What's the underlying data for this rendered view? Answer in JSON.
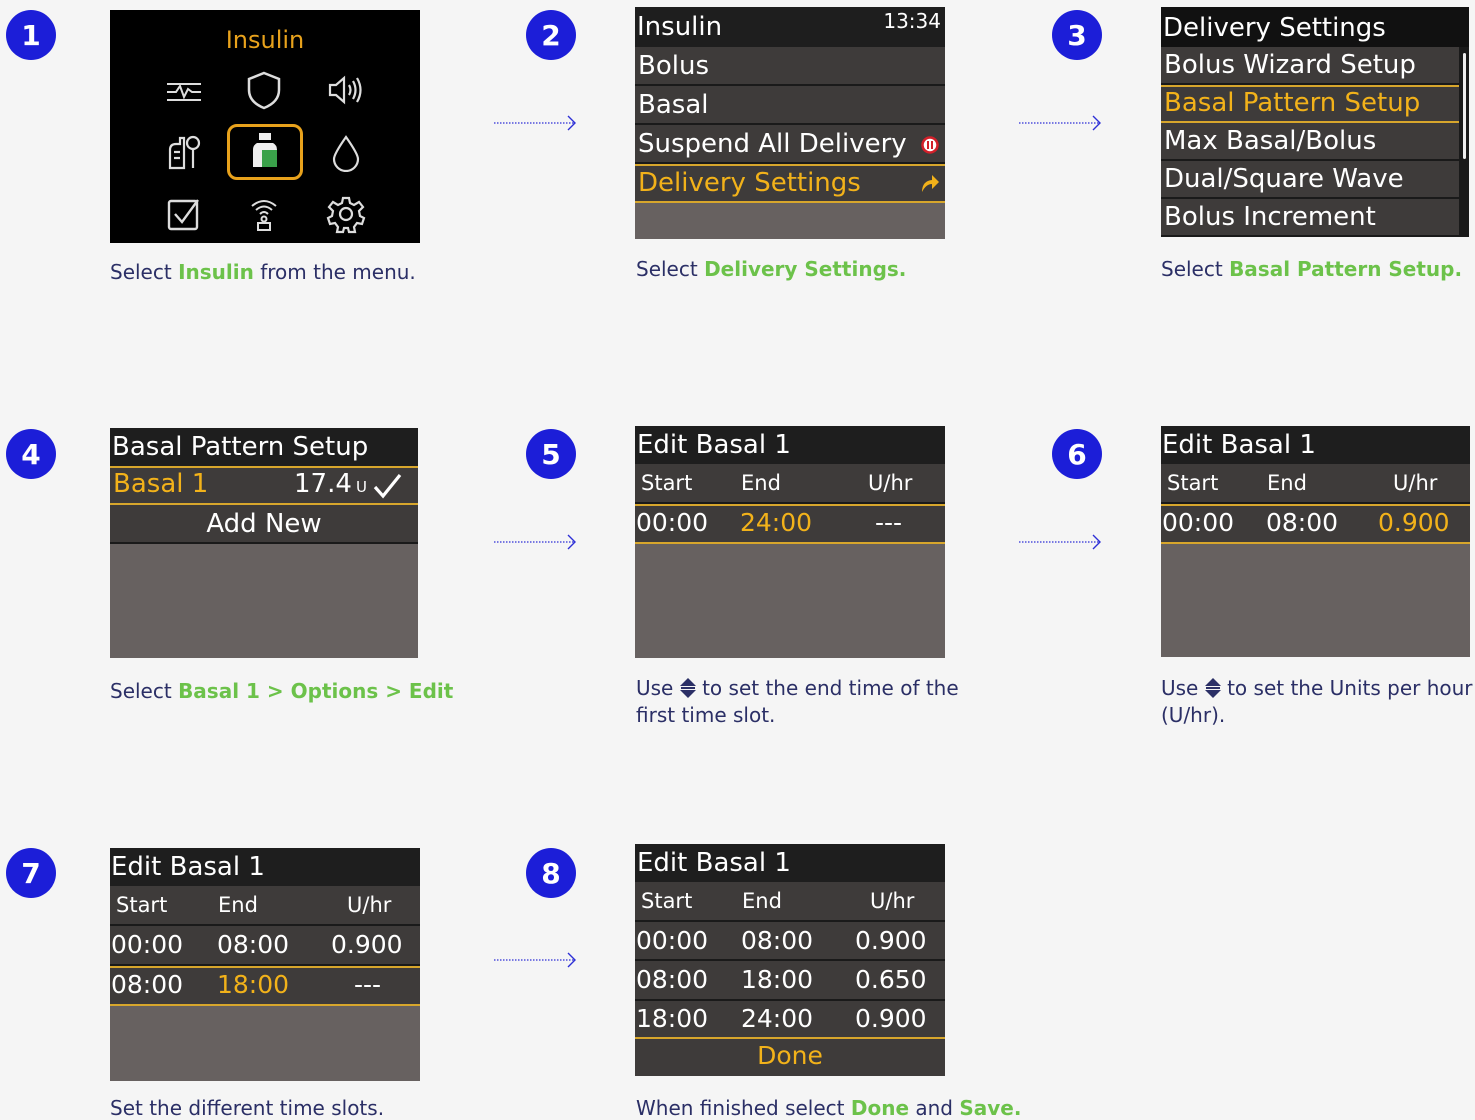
{
  "steps": [
    {
      "num": "1",
      "caption_pre": "Select ",
      "caption_hl": "Insulin",
      "caption_post": " from the menu."
    },
    {
      "num": "2",
      "caption_pre": "Select ",
      "caption_hl": "Delivery Settings.",
      "caption_post": ""
    },
    {
      "num": "3",
      "caption_pre": "Select ",
      "caption_hl": "Basal Pattern Setup.",
      "caption_post": ""
    },
    {
      "num": "4",
      "caption_pre": "Select ",
      "caption_hl": "Basal 1 > Options > Edit",
      "caption_post": ""
    },
    {
      "num": "5",
      "caption_line1": "Use",
      "caption_line1b": "to set the end time of the",
      "caption_line2": "first time slot."
    },
    {
      "num": "6",
      "caption_line1": "Use",
      "caption_line1b": "to set the Units per hour",
      "caption_line2": "(U/hr)."
    },
    {
      "num": "7",
      "caption_pre": "Set the different time slots.",
      "caption_hl": "",
      "caption_post": ""
    },
    {
      "num": "8",
      "caption_pre": "When finished select ",
      "caption_hl": "Done",
      "caption_mid": " and ",
      "caption_hl2": "Save."
    }
  ],
  "screen1": {
    "title": "Insulin",
    "icons": [
      "sensor-graph-icon",
      "shield-icon",
      "speaker-icon",
      "reservoir-icon",
      "insulin-vial-icon",
      "drop-icon",
      "checkbox-icon",
      "connection-icon",
      "gear-icon"
    ]
  },
  "screen2": {
    "title": "Insulin",
    "time": "13:34",
    "items": [
      "Bolus",
      "Basal",
      "Suspend All Delivery",
      "Delivery Settings"
    ]
  },
  "screen3": {
    "title": "Delivery Settings",
    "items": [
      "Bolus Wizard Setup",
      "Basal Pattern Setup",
      "Max Basal/Bolus",
      "Dual/Square Wave",
      "Bolus Increment"
    ]
  },
  "screen4": {
    "title": "Basal Pattern Setup",
    "pattern_name": "Basal 1",
    "pattern_total": "17.4",
    "pattern_unit": "U",
    "add_new": "Add New"
  },
  "edit_title": "Edit Basal 1",
  "headers": {
    "start": "Start",
    "end": "End",
    "rate": "U/hr"
  },
  "screen5": {
    "rows": [
      {
        "start": "00:00",
        "end": "24:00",
        "rate": "---"
      }
    ]
  },
  "screen6": {
    "rows": [
      {
        "start": "00:00",
        "end": "08:00",
        "rate": "0.900"
      }
    ]
  },
  "screen7": {
    "rows": [
      {
        "start": "00:00",
        "end": "08:00",
        "rate": "0.900"
      },
      {
        "start": "08:00",
        "end": "18:00",
        "rate": "---"
      }
    ]
  },
  "screen8": {
    "rows": [
      {
        "start": "00:00",
        "end": "08:00",
        "rate": "0.900"
      },
      {
        "start": "08:00",
        "end": "18:00",
        "rate": "0.650"
      },
      {
        "start": "18:00",
        "end": "24:00",
        "rate": "0.900"
      }
    ],
    "done": "Done"
  },
  "colors": {
    "badge": "#1c1ed8",
    "highlight_text": "#6cc24a",
    "selection_gold": "#f2b21a",
    "caption": "#2b2f66"
  }
}
